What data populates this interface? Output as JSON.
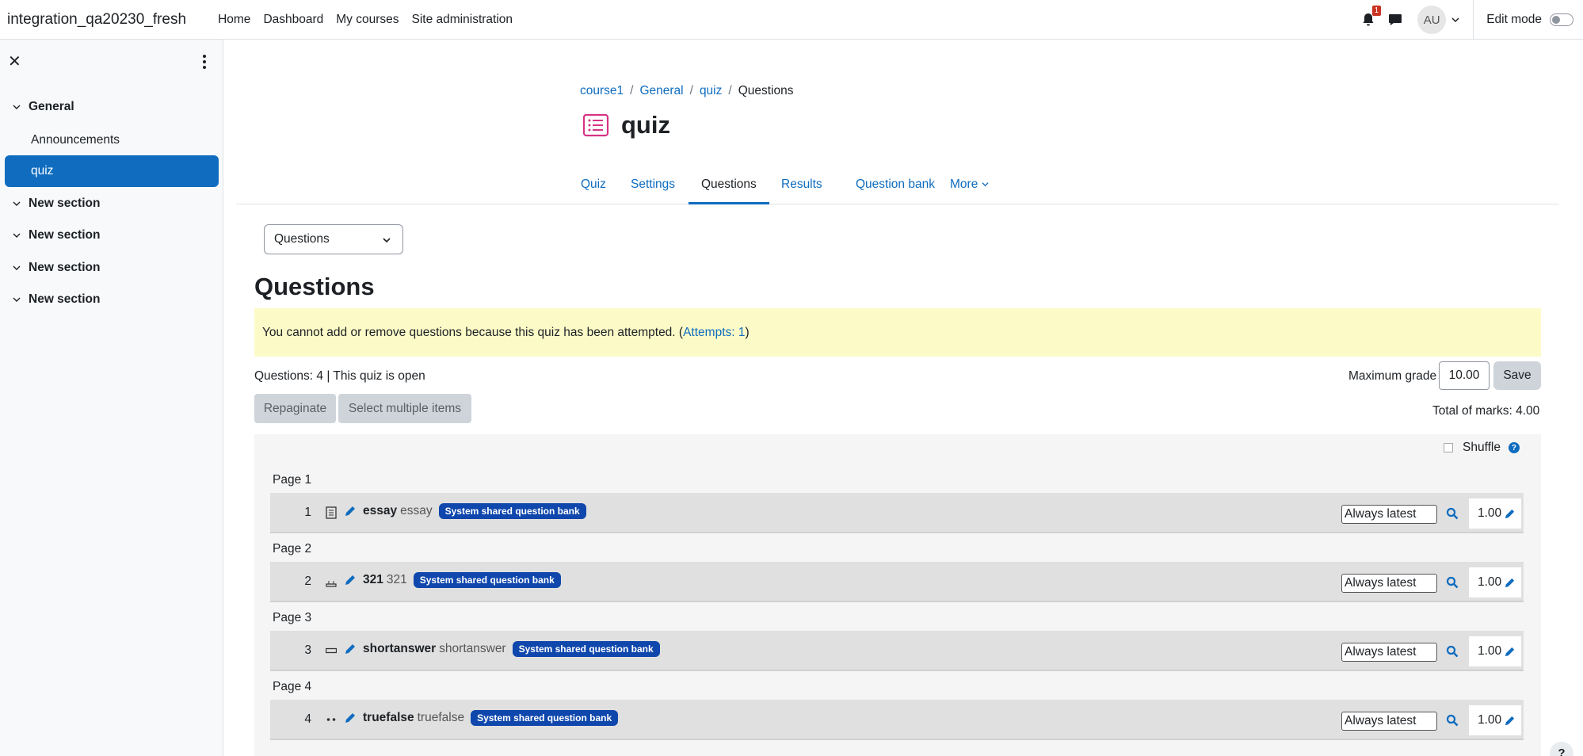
{
  "navbar": {
    "brand": "integration_qa20230_fresh",
    "links": [
      "Home",
      "Dashboard",
      "My courses",
      "Site administration"
    ],
    "notification_count": "1",
    "avatar_initials": "AU",
    "edit_mode_label": "Edit mode"
  },
  "drawer": {
    "sections": [
      {
        "title": "General"
      },
      {
        "title": "New section"
      },
      {
        "title": "New section"
      },
      {
        "title": "New section"
      },
      {
        "title": "New section"
      }
    ],
    "items": [
      "Announcements",
      "quiz"
    ]
  },
  "breadcrumb": [
    "course1",
    "General",
    "quiz",
    "Questions"
  ],
  "page_title": "quiz",
  "tabs": [
    "Quiz",
    "Settings",
    "Questions",
    "Results",
    "Question bank",
    "More"
  ],
  "selector_value": "Questions",
  "heading": "Questions",
  "alert": {
    "text": "You cannot add or remove questions because this quiz has been attempted. (",
    "link": "Attempts: 1",
    "close": ")"
  },
  "summary": "Questions: 4 | This quiz is open",
  "max_grade_label": "Maximum grade",
  "max_grade_value": "10.00",
  "save_label": "Save",
  "repaginate_label": "Repaginate",
  "select_multiple_label": "Select multiple items",
  "total_marks": "Total of marks: 4.00",
  "shuffle_label": "Shuffle",
  "pages": [
    {
      "label": "Page 1",
      "number": "1",
      "name": "essay",
      "text": "essay",
      "badge": "System shared question bank",
      "version": "Always latest",
      "mark": "1.00",
      "icon": "essay-icon"
    },
    {
      "label": "Page 2",
      "number": "2",
      "name": "321",
      "text": "321",
      "badge": "System shared question bank",
      "version": "Always latest",
      "mark": "1.00",
      "icon": "numerical-icon"
    },
    {
      "label": "Page 3",
      "number": "3",
      "name": "shortanswer",
      "text": "shortanswer",
      "badge": "System shared question bank",
      "version": "Always latest",
      "mark": "1.00",
      "icon": "shortanswer-icon"
    },
    {
      "label": "Page 4",
      "number": "4",
      "name": "truefalse",
      "text": "truefalse",
      "badge": "System shared question bank",
      "version": "Always latest",
      "mark": "1.00",
      "icon": "truefalse-icon"
    }
  ],
  "help_label": "?"
}
